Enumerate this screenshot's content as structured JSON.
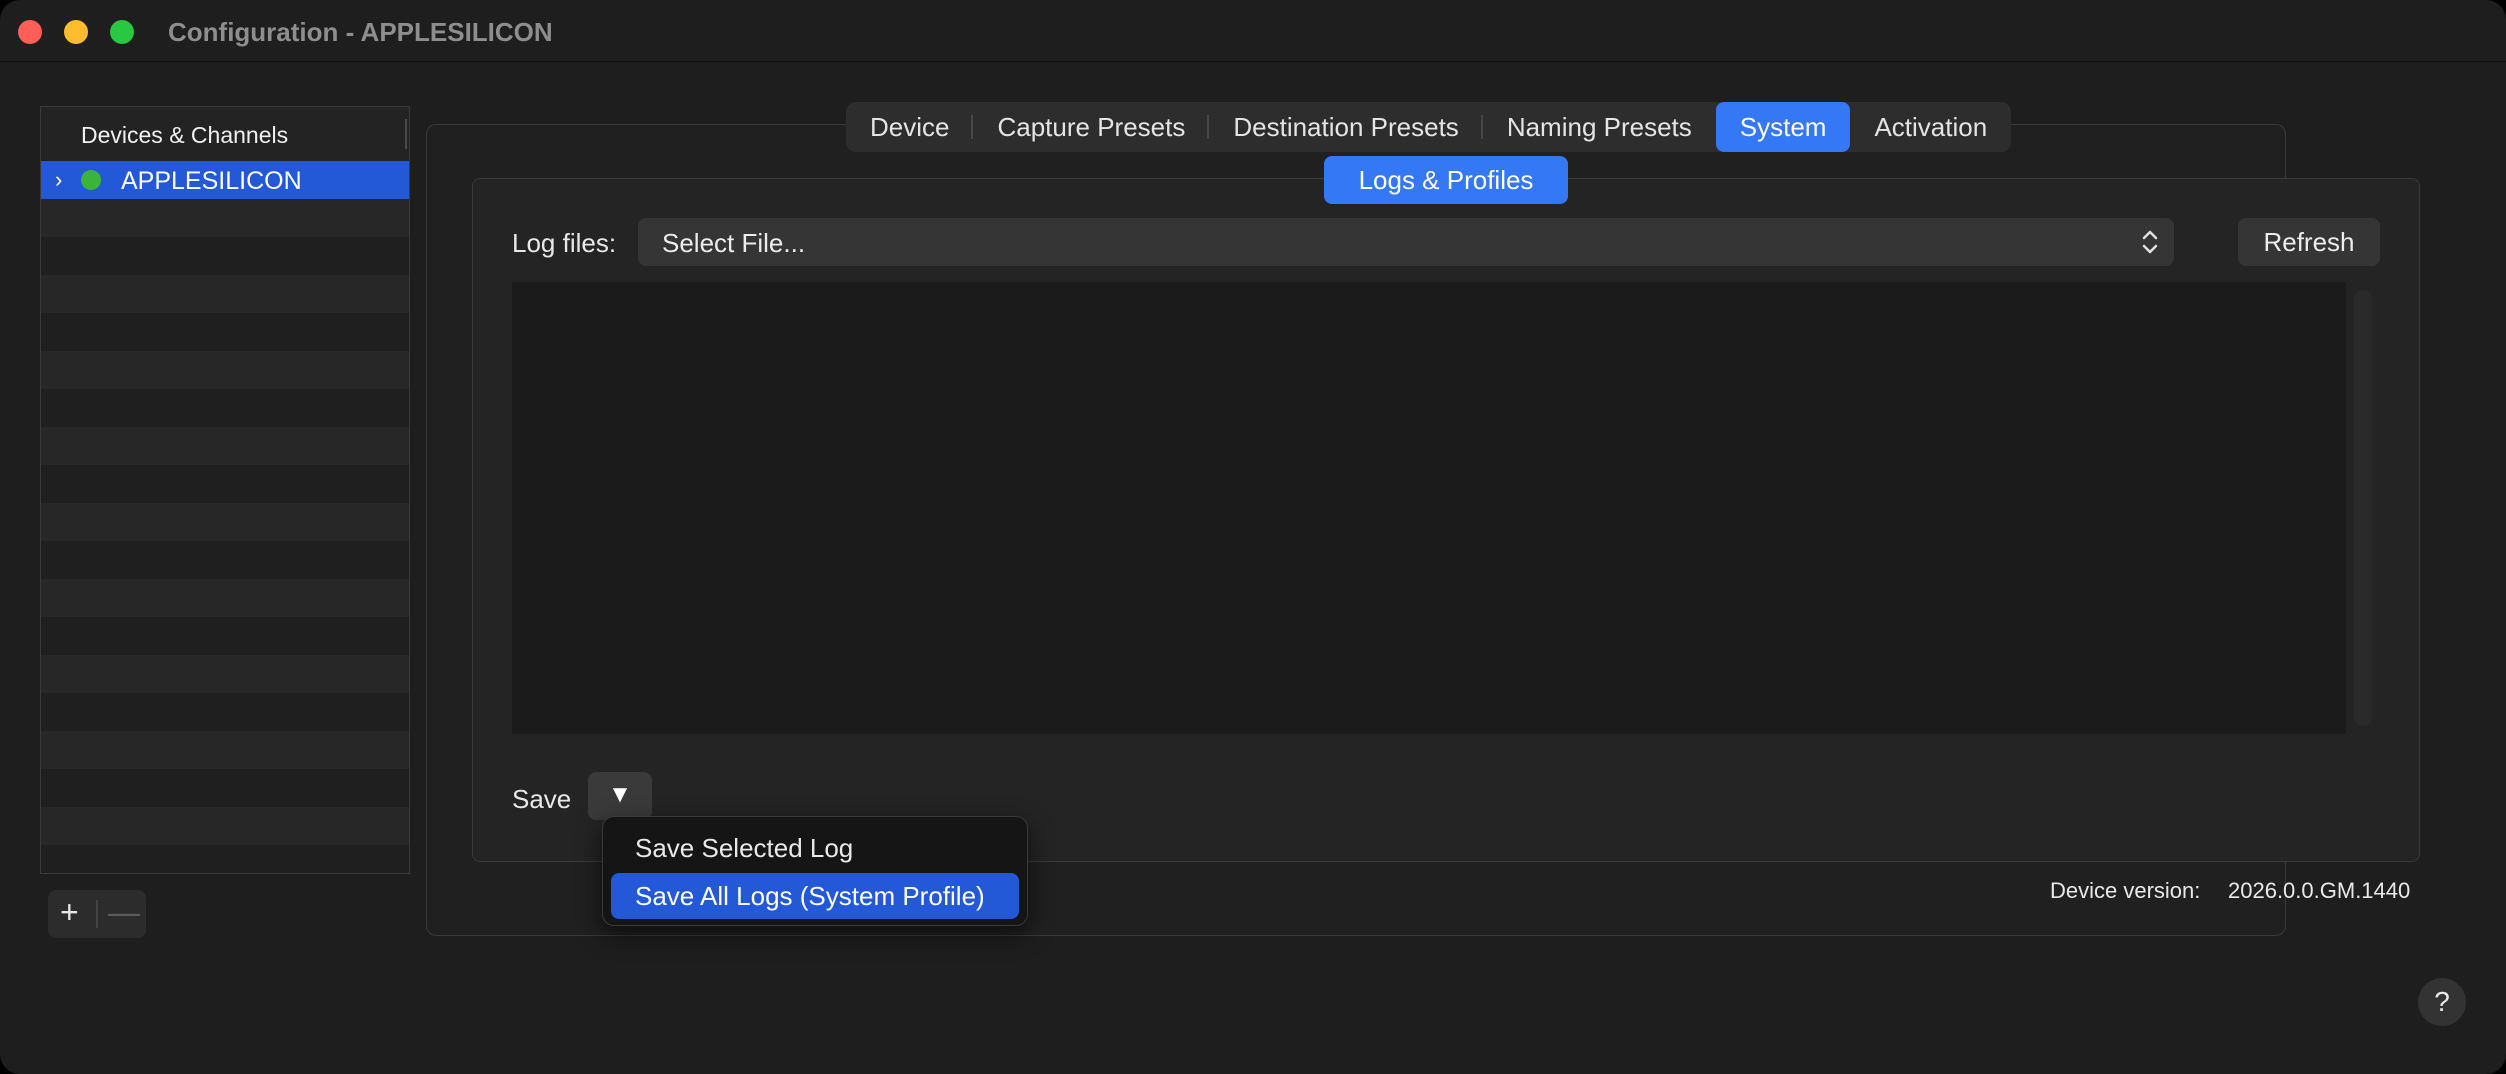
{
  "window": {
    "title": "Configuration - APPLESILICON"
  },
  "sidebar": {
    "header": "Devices & Channels",
    "items": [
      {
        "label": "APPLESILICON",
        "status": "online",
        "status_color": "#3bb43b",
        "expand_icon": "chevron-right-icon"
      }
    ],
    "add_symbol": "+",
    "remove_symbol": "—"
  },
  "tabs": {
    "items": [
      {
        "label": "Device"
      },
      {
        "label": "Capture Presets"
      },
      {
        "label": "Destination Presets"
      },
      {
        "label": "Naming Presets"
      },
      {
        "label": "System",
        "active": true
      },
      {
        "label": "Activation"
      }
    ],
    "accent_color": "#3478f6"
  },
  "system": {
    "subtab": "Logs & Profiles",
    "log_files_label": "Log files:",
    "log_select_value": "Select File...",
    "refresh_label": "Refresh",
    "save_label": "Save",
    "save_dropdown_symbol": "▼",
    "menu": {
      "items": [
        {
          "label": "Save Selected Log"
        },
        {
          "label": "Save All Logs (System Profile)",
          "highlighted": true
        }
      ]
    },
    "device_version_label": "Device version:",
    "device_version_value": "2026.0.0.GM.1440"
  },
  "help_symbol": "?"
}
